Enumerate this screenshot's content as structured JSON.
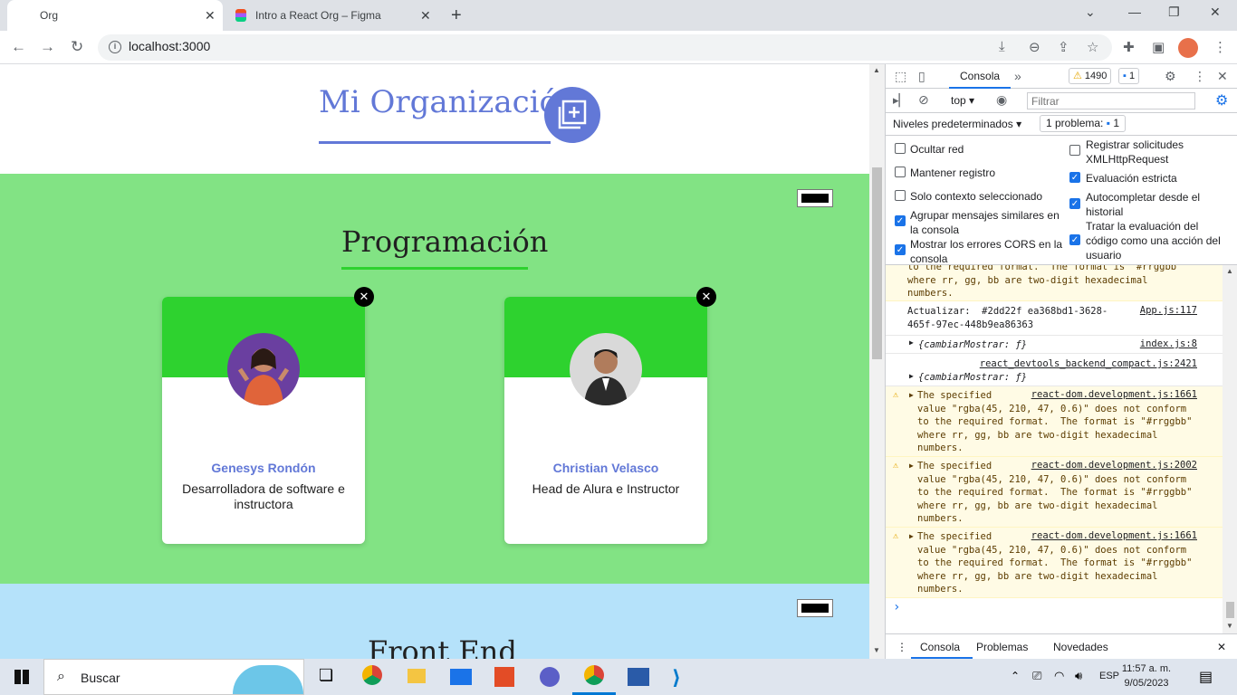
{
  "browser": {
    "tabs": [
      {
        "title": "Org",
        "close": "✕"
      },
      {
        "title": "Intro a React Org – Figma",
        "close": "✕"
      }
    ],
    "new_tab": "+",
    "url": "localhost:3000"
  },
  "page": {
    "org_title": "Mi Organización",
    "teams": [
      {
        "title": "Programación",
        "primary_color": "#2ed22f",
        "secondary_color": "#82e384",
        "members": [
          {
            "name": "Genesys Rondón",
            "role": "Desarrolladora de software e instructora"
          },
          {
            "name": "Christian Velasco",
            "role": "Head de Alura e Instructor"
          }
        ]
      },
      {
        "title": "Front End",
        "secondary_color": "#b5e2fa"
      }
    ]
  },
  "devtools": {
    "tab_console": "Consola",
    "warnings_count": "1490",
    "messages_count": "1",
    "context": "top",
    "filter_placeholder": "Filtrar",
    "levels": "Niveles predeterminados",
    "issues": "1 problema:",
    "issues_count": "1",
    "settings_left": [
      {
        "label": "Ocultar red",
        "checked": false
      },
      {
        "label": "Mantener registro",
        "checked": false
      },
      {
        "label": "Solo contexto seleccionado",
        "checked": false
      },
      {
        "label": "Agrupar mensajes similares en la consola",
        "checked": true
      },
      {
        "label": "Mostrar los errores CORS en la consola",
        "checked": true
      }
    ],
    "settings_right": [
      {
        "label": "Registrar solicitudes XMLHttpRequest",
        "checked": false
      },
      {
        "label": "Evaluación estricta",
        "checked": true
      },
      {
        "label": "Autocompletar desde el historial",
        "checked": true
      },
      {
        "label": "Tratar la evaluación del código como una acción del usuario",
        "checked": true
      }
    ],
    "console": {
      "m0": "to the required format.  The format is \"#rrggbb\"\nwhere rr, gg, bb are two-digit hexadecimal\nnumbers.",
      "m1": "Actualizar:  #2dd22f ea368bd1-3628-\n465f-97ec-448b9ea86363",
      "m1_src": "App.js:117",
      "m2": "{cambiarMostrar: ƒ}",
      "m2_src": "index.js:8",
      "m3_src": "react_devtools_backend_compact.js:2421",
      "m3": "{cambiarMostrar: ƒ}",
      "w1": "The specified\nvalue \"rgba(45, 210, 47, 0.6)\" does not conform\nto the required format.  The format is \"#rrggbb\"\nwhere rr, gg, bb are two-digit hexadecimal\nnumbers.",
      "w1_src": "react-dom.development.js:1661",
      "w2": "The specified\nvalue \"rgba(45, 210, 47, 0.6)\" does not conform\nto the required format.  The format is \"#rrggbb\"\nwhere rr, gg, bb are two-digit hexadecimal\nnumbers.",
      "w2_src": "react-dom.development.js:2002",
      "w3": "The specified\nvalue \"rgba(45, 210, 47, 0.6)\" does not conform\nto the required format.  The format is \"#rrggbb\"\nwhere rr, gg, bb are two-digit hexadecimal\nnumbers.",
      "w3_src": "react-dom.development.js:1661",
      "prompt": "›"
    },
    "drawer_tabs": [
      "Consola",
      "Problemas",
      "Novedades"
    ]
  },
  "taskbar": {
    "search": "Buscar",
    "lang": "ESP",
    "time": "11:57 a. m.",
    "date": "9/05/2023"
  }
}
